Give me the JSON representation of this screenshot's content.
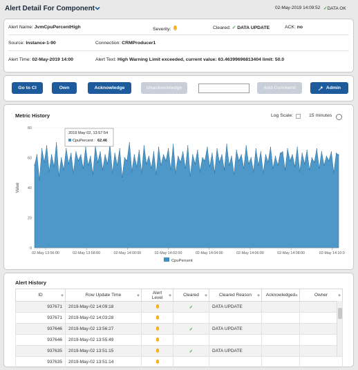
{
  "header": {
    "title": "Alert Detail For Component",
    "date": "02-May-2019 14:09:52",
    "status": "DATA OK"
  },
  "info": {
    "alert_name_label": "Alert Name:",
    "alert_name": "JvmCpuPercentHigh",
    "severity_label": "Severity:",
    "cleared_label": "Cleared:",
    "cleared_value": "DATA UPDATE",
    "ack_label": "ACK:",
    "ack_value": "no",
    "source_label": "Source:",
    "source": "Instance-1-90",
    "connection_label": "Connection:",
    "connection": "CRMProducer1",
    "alert_time_label": "Alert Time:",
    "alert_time": "02-May-2019 14:00",
    "alert_text_label": "Alert Text:",
    "alert_text": "High Warning Limit exceeded, current value: 63.46399696813404 limit: 50.0"
  },
  "actions": {
    "go_to_ci": "Go to CI",
    "own": "Own",
    "acknowledge": "Acknowledge",
    "unacknowledge": "Unacknowledge",
    "comment_placeholder": "",
    "add_comment": "Add Comment",
    "admin": "Admin"
  },
  "metric": {
    "title": "Metric History",
    "log_scale_label": "Log Scale:",
    "range_label": "15 minutes",
    "tooltip_time": "2019 May 02, 13:57:54",
    "tooltip_series": "CpuPercent :",
    "tooltip_value": "62.46"
  },
  "chart_data": {
    "type": "area",
    "ylabel": "Value",
    "ylim": [
      0,
      80
    ],
    "yticks": [
      "0",
      "20",
      "40",
      "60",
      "80"
    ],
    "xtick_labels": [
      "02-May 13:56:00",
      "02-May 13:58:00",
      "02-May 14:00:00",
      "02-May 14:02:00",
      "02-May 14:04:00",
      "02-May 14:06:00",
      "02-May 14:08:00",
      "02-May 14:10:0"
    ],
    "series": [
      {
        "name": "CpuPercent",
        "color": "#3e8fc3",
        "values": [
          55,
          62,
          45,
          66,
          57,
          68,
          51,
          62,
          54,
          70,
          48,
          60,
          52,
          66,
          56,
          63,
          50,
          64,
          58,
          62,
          53,
          67,
          55,
          61,
          49,
          68,
          57,
          64,
          52,
          62,
          56,
          69,
          50,
          63,
          55,
          66,
          47,
          60,
          58,
          70,
          51,
          62,
          54,
          65,
          50,
          68,
          56,
          61,
          53,
          64,
          49,
          67,
          55,
          62,
          58,
          66,
          52,
          69,
          50,
          61,
          57,
          64,
          53,
          68,
          48,
          62,
          56,
          65,
          51,
          60,
          58,
          67,
          54,
          63,
          50,
          66,
          57,
          62,
          52,
          69,
          55,
          61,
          49,
          65,
          58,
          62,
          53,
          68,
          56,
          60,
          51,
          66,
          55,
          64,
          50,
          62,
          57,
          67,
          53,
          61,
          55,
          63,
          64,
          52,
          66,
          58,
          62,
          54,
          67,
          51,
          63,
          56,
          65,
          52,
          60,
          57,
          66,
          53,
          64,
          55,
          61,
          58,
          64,
          50,
          63,
          62
        ]
      }
    ]
  },
  "history": {
    "title": "Alert History",
    "columns": [
      "ID",
      "Row Update Time",
      "Alert Level",
      "Cleared",
      "Cleared Reason",
      "Acknowledged",
      "Owner"
    ],
    "rows": [
      {
        "id": "937671",
        "time": "2019-May-02 14:09:18",
        "level": "bell",
        "cleared": true,
        "reason": "DATA UPDATE",
        "ack": "",
        "owner": ""
      },
      {
        "id": "937671",
        "time": "2019-May-02 14:03:28",
        "level": "bell",
        "cleared": false,
        "reason": "",
        "ack": "",
        "owner": ""
      },
      {
        "id": "937646",
        "time": "2019-May-02 13:56:27",
        "level": "bell",
        "cleared": true,
        "reason": "DATA UPDATE",
        "ack": "",
        "owner": ""
      },
      {
        "id": "937646",
        "time": "2019-May-02 13:55:49",
        "level": "bell",
        "cleared": false,
        "reason": "",
        "ack": "",
        "owner": ""
      },
      {
        "id": "937635",
        "time": "2019-May-02 13:51:15",
        "level": "bell",
        "cleared": true,
        "reason": "DATA UPDATE",
        "ack": "",
        "owner": ""
      },
      {
        "id": "937635",
        "time": "2019-May-02 13:51:14",
        "level": "bell",
        "cleared": false,
        "reason": "",
        "ack": "",
        "owner": ""
      }
    ]
  },
  "colors": {
    "accent": "#1d5b9c",
    "bell": "#f2b21b",
    "check": "#3aa03a",
    "area": "#3e8fc3"
  }
}
